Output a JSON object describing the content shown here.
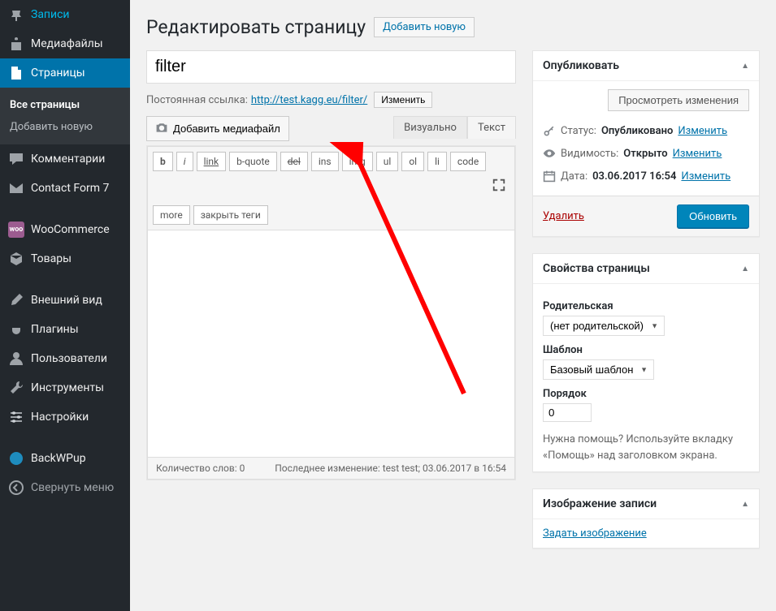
{
  "sidebar": {
    "items": [
      {
        "label": "Записи"
      },
      {
        "label": "Медиафайлы"
      },
      {
        "label": "Страницы"
      },
      {
        "label": "Комментарии"
      },
      {
        "label": "Contact Form 7"
      },
      {
        "label": "WooCommerce"
      },
      {
        "label": "Товары"
      },
      {
        "label": "Внешний вид"
      },
      {
        "label": "Плагины"
      },
      {
        "label": "Пользователи"
      },
      {
        "label": "Инструменты"
      },
      {
        "label": "Настройки"
      },
      {
        "label": "BackWPup"
      },
      {
        "label": "Свернуть меню"
      }
    ],
    "submenu": [
      {
        "label": "Все страницы"
      },
      {
        "label": "Добавить новую"
      }
    ]
  },
  "header": {
    "title": "Редактировать страницу",
    "add_new": "Добавить новую"
  },
  "editor": {
    "post_title": "filter",
    "permalink_label": "Постоянная ссылка:",
    "permalink_base": "http://test.kagg.eu/",
    "permalink_slug": "filter/",
    "permalink_edit": "Изменить",
    "add_media": "Добавить медиафайл",
    "tab_visual": "Визуально",
    "tab_text": "Текст",
    "toolbar": [
      "b",
      "i",
      "link",
      "b-quote",
      "del",
      "ins",
      "img",
      "ul",
      "ol",
      "li",
      "code"
    ],
    "toolbar2": [
      "more",
      "закрыть теги"
    ],
    "word_count_label": "Количество слов: 0",
    "last_edit": "Последнее изменение: test test; 03.06.2017 в 16:54"
  },
  "publish": {
    "box_title": "Опубликовать",
    "preview": "Просмотреть изменения",
    "status_label": "Статус:",
    "status_value": "Опубликовано",
    "status_edit": "Изменить",
    "visibility_label": "Видимость:",
    "visibility_value": "Открыто",
    "visibility_edit": "Изменить",
    "date_label": "Дата:",
    "date_value": "03.06.2017 16:54",
    "date_edit": "Изменить",
    "delete": "Удалить",
    "update": "Обновить"
  },
  "page_attrs": {
    "box_title": "Свойства страницы",
    "parent_label": "Родительская",
    "parent_value": "(нет родительской)",
    "template_label": "Шаблон",
    "template_value": "Базовый шаблон",
    "order_label": "Порядок",
    "order_value": "0",
    "help": "Нужна помощь? Используйте вкладку «Помощь» над заголовком экрана."
  },
  "featured": {
    "box_title": "Изображение записи",
    "set_link": "Задать изображение"
  }
}
